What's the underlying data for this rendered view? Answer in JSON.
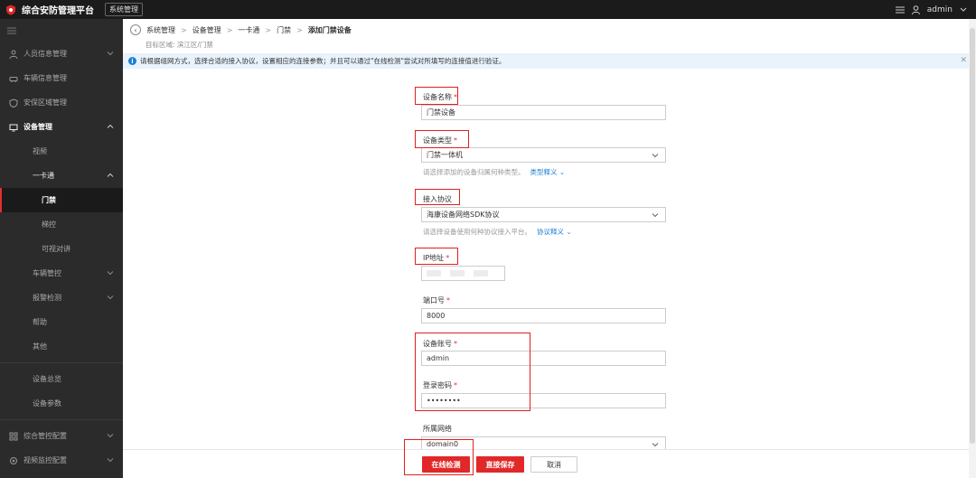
{
  "topbar": {
    "title": "综合安防管理平台",
    "badge": "系统管理",
    "user": "admin"
  },
  "sidebar": {
    "items": [
      {
        "label": "人员信息管理",
        "icon": "person-icon"
      },
      {
        "label": "车辆信息管理",
        "icon": "car-icon"
      },
      {
        "label": "安保区域管理",
        "icon": "shield-icon"
      },
      {
        "label": "设备管理",
        "icon": "device-icon"
      },
      {
        "label": "视频"
      },
      {
        "label": "一卡通"
      },
      {
        "label": "门禁"
      },
      {
        "label": "梯控"
      },
      {
        "label": "可视对讲"
      },
      {
        "label": "车辆管控"
      },
      {
        "label": "报警检测"
      },
      {
        "label": "帮助"
      },
      {
        "label": "其他"
      },
      {
        "label": "设备总览"
      },
      {
        "label": "设备参数"
      },
      {
        "label": "综合管控配置",
        "icon": "grid-icon"
      },
      {
        "label": "视频监控配置",
        "icon": "camera-icon"
      }
    ]
  },
  "breadcrumb": [
    "系统管理",
    "设备管理",
    "一卡通",
    "门禁",
    "添加门禁设备"
  ],
  "target_area": "目标区域: 滨江区/门禁",
  "banner": "请根据组网方式，选择合适的接入协议，设置相应的连接参数；并且可以通过\"在线检测\"尝试对所填写的连接值进行验证。",
  "form": {
    "device_name": {
      "label": "设备名称",
      "value": "门禁设备"
    },
    "device_type": {
      "label": "设备类型",
      "value": "门禁一体机",
      "hint": "请选择添加的设备归属何种类型。",
      "link": "类型释义"
    },
    "protocol": {
      "label": "接入协议",
      "value": "海康设备网络SDK协议",
      "hint": "请选择设备使用何种协议接入平台。",
      "link": "协议释义"
    },
    "ip": {
      "label": "IP地址"
    },
    "port": {
      "label": "端口号",
      "value": "8000"
    },
    "account": {
      "label": "设备账号",
      "value": "admin"
    },
    "password": {
      "label": "登录密码",
      "value": "••••••••"
    },
    "network": {
      "label": "所属网络",
      "value": "domain0"
    }
  },
  "buttons": {
    "online_check": "在线检测",
    "save": "直接保存",
    "cancel": "取消"
  }
}
